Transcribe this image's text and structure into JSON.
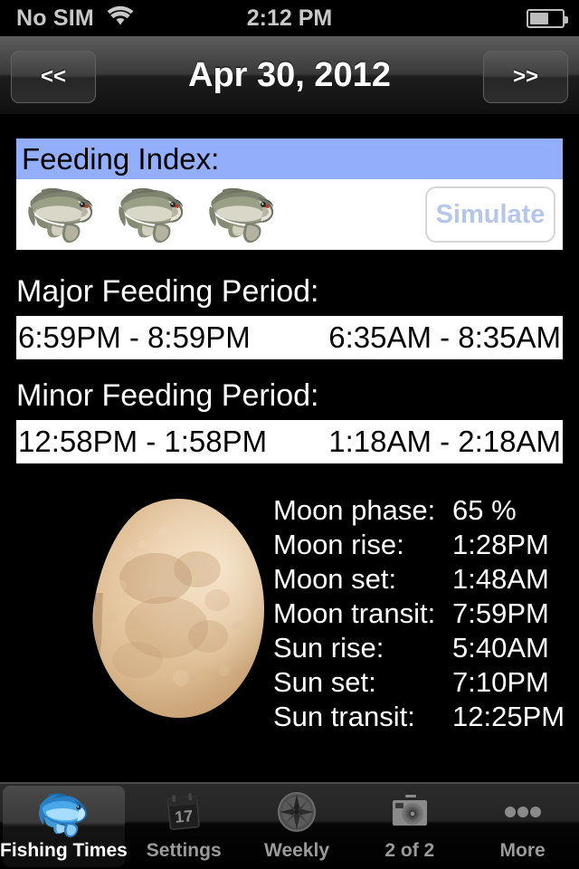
{
  "status_bar": {
    "carrier": "No SIM",
    "wifi_icon": "wifi-icon",
    "time": "2:12 PM",
    "battery_icon": "battery-icon",
    "battery_percent": 58
  },
  "nav_bar": {
    "prev_label": "<<",
    "title": "Apr 30, 2012",
    "next_label": ">>"
  },
  "feeding_index": {
    "header": "Feeding Index:",
    "fish_count": 3,
    "fish_icon": "bass-fish-icon",
    "simulate_label": "Simulate"
  },
  "major_period": {
    "label": "Major Feeding Period:",
    "first": "6:59PM - 8:59PM",
    "second": "6:35AM - 8:35AM"
  },
  "minor_period": {
    "label": "Minor Feeding Period:",
    "first": "12:58PM - 1:58PM",
    "second": "1:18AM - 2:18AM"
  },
  "moon": {
    "image_icon": "moon-waning-gibbous-image"
  },
  "astro": {
    "rows": [
      {
        "key": "Moon phase:",
        "value": "65 %"
      },
      {
        "key": "Moon rise:",
        "value": "1:28PM"
      },
      {
        "key": "Moon set:",
        "value": "1:48AM"
      },
      {
        "key": "Moon transit:",
        "value": "7:59PM"
      },
      {
        "key": "Sun rise:",
        "value": "5:40AM"
      },
      {
        "key": "Sun set:",
        "value": "7:10PM"
      },
      {
        "key": "Sun transit:",
        "value": "12:25PM"
      }
    ]
  },
  "tab_bar": {
    "tabs": [
      {
        "label": "Fishing Times",
        "icon": "fish-icon",
        "active": true
      },
      {
        "label": "Settings",
        "icon": "calendar-icon",
        "active": false
      },
      {
        "label": "Weekly",
        "icon": "compass-icon",
        "active": false
      },
      {
        "label": "2 of 2",
        "icon": "camera-icon",
        "active": false
      },
      {
        "label": "More",
        "icon": "ellipsis-icon",
        "active": false
      }
    ],
    "calendar_day": "17"
  },
  "colors": {
    "index_header_blue": "#93affc",
    "simulate_text": "#b6c6e8",
    "status_text": "#c8c8c8",
    "moon_tan": "#d9b289"
  }
}
